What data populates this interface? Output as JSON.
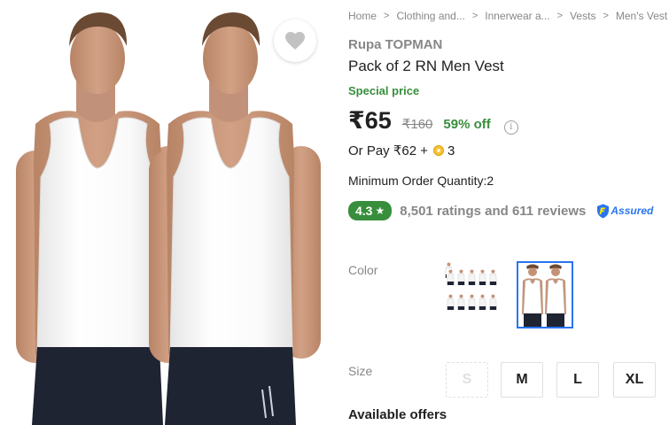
{
  "breadcrumbs": [
    "Home",
    "Clothing and...",
    "Innerwear a...",
    "Vests",
    "Men's Vest"
  ],
  "product": {
    "brand": "Rupa TOPMAN",
    "title": "Pack of 2 RN Men Vest",
    "special_label": "Special price",
    "price": "₹65",
    "mrp": "₹160",
    "discount": "59% off",
    "or_pay_prefix": "Or Pay ₹62 +",
    "or_pay_coins": "3",
    "min_order": "Minimum Order Quantity:2",
    "rating": "4.3",
    "rating_star": "★",
    "rating_summary": "8,501 ratings and 611 reviews",
    "assured_label": "Assured"
  },
  "options": {
    "color_label": "Color",
    "size_label": "Size",
    "sizes": [
      "S",
      "M",
      "L",
      "XL"
    ],
    "unavailable_sizes": [
      "S"
    ],
    "selected_color_index": 1
  },
  "offers_heading": "Available offers",
  "icons": {
    "wishlist": "heart-icon",
    "breadcrumb_separator": "chevron-right-icon",
    "info": "info-icon",
    "coin": "supercoin-icon",
    "assured": "assured-shield-icon"
  },
  "colors": {
    "accent": "#2874f0",
    "green": "#388e3c",
    "muted": "#878787",
    "text": "#212121"
  }
}
